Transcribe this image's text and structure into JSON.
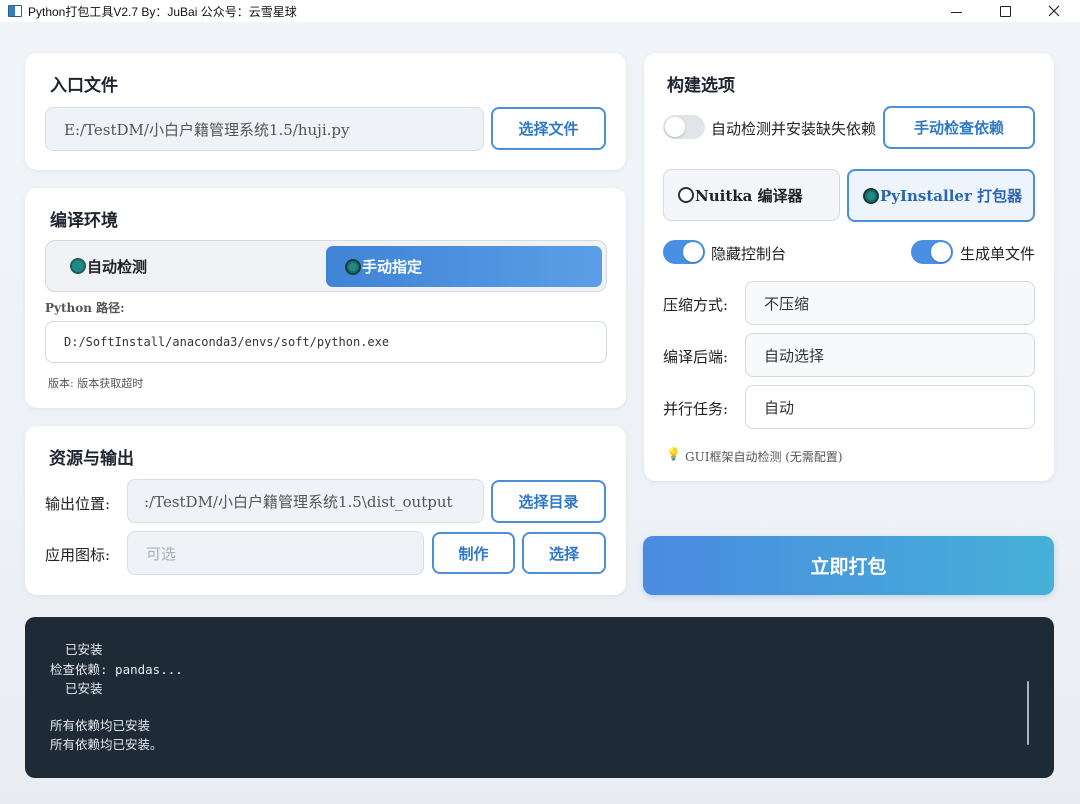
{
  "window": {
    "title": "Python打包工具V2.7 By：JuBai 公众号：云雪星球"
  },
  "entry": {
    "title": "入口文件",
    "path": "E:/TestDM/小白户籍管理系统1.5/huji.py",
    "select_button": "选择文件"
  },
  "env": {
    "title": "编译环境",
    "options": [
      "自动检测",
      "手动指定"
    ],
    "selected": "手动指定",
    "python_path_label": "Python 路径:",
    "python_path": "D:/SoftInstall/anaconda3/envs/soft/python.exe",
    "version_text": "版本: 版本获取超时"
  },
  "resources": {
    "title": "资源与输出",
    "output_label": "输出位置:",
    "output_path": ":/TestDM/小白户籍管理系统1.5\\dist_output",
    "select_dir_button": "选择目录",
    "icon_label": "应用图标:",
    "icon_placeholder": "可选",
    "make_button": "制作",
    "choose_button": "选择"
  },
  "build": {
    "title": "构建选项",
    "auto_deps_label": "自动检测并安装缺失依赖",
    "auto_deps_on": false,
    "check_deps_button": "手动检查依赖",
    "compilers": [
      "Nuitka 编译器",
      "PyInstaller 打包器"
    ],
    "selected_compiler": "PyInstaller 打包器",
    "hide_console_label": "隐藏控制台",
    "hide_console_on": true,
    "onefile_label": "生成单文件",
    "onefile_on": true,
    "compress_label": "压缩方式:",
    "compress_value": "不压缩",
    "backend_label": "编译后端:",
    "backend_value": "自动选择",
    "jobs_label": "并行任务:",
    "jobs_value": "自动",
    "gui_hint": "GUI框架自动检测 (无需配置)",
    "hint_icon": "lightbulb-icon"
  },
  "pack_button": "立即打包",
  "console": {
    "lines": [
      "  已安装",
      "检查依赖: pandas...",
      "  已安装",
      "",
      "所有依赖均已安装",
      "所有依赖均已安装。"
    ]
  },
  "colors": {
    "accent": "#4a90e2",
    "console_bg": "#1f2a37",
    "radio_selected": "#1f8a84"
  }
}
